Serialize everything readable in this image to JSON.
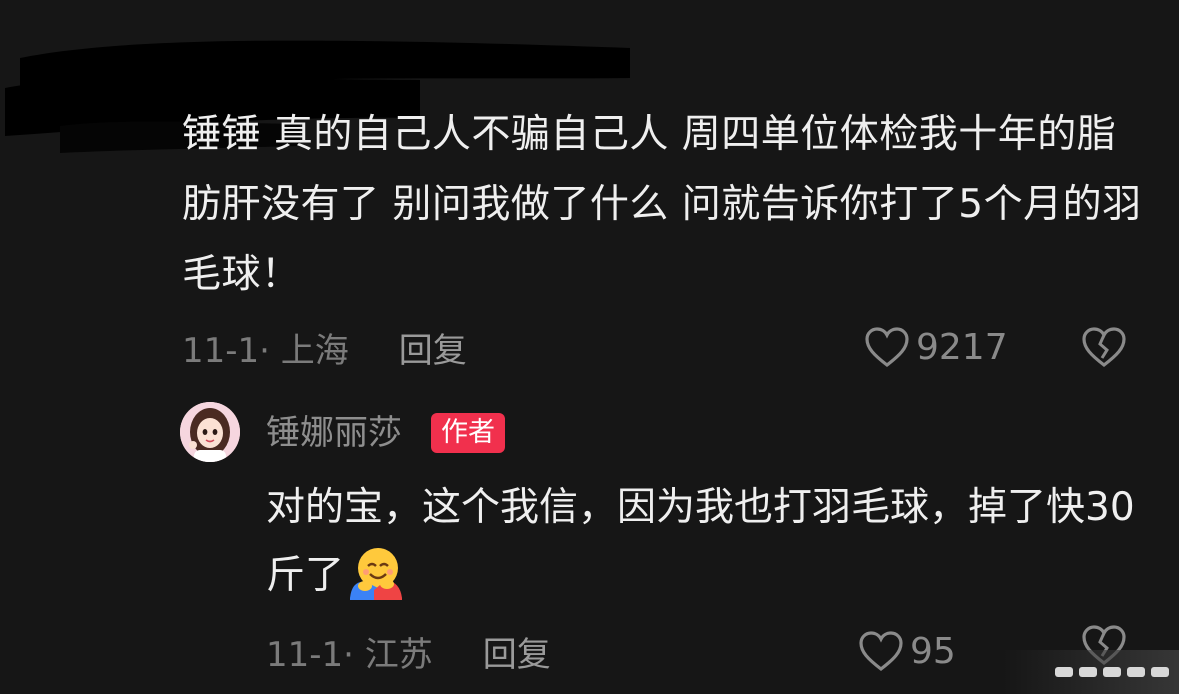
{
  "comment": {
    "text": "锤锤 真的自己人不骗自己人 周四单位体检我十年的脂肪肝没有了 别问我做了什么 问就告诉你打了5个月的羽毛球！",
    "date_location": "11-1· 上海",
    "reply_label": "回复",
    "likes": "9217"
  },
  "reply": {
    "username": "锤娜丽莎",
    "badge": "作者",
    "text": "对的宝，这个我信，因为我也打羽毛球，掉了快30斤了",
    "emoji": "hugging-face-icon",
    "date_location": "11-1· 江苏",
    "reply_label": "回复",
    "likes": "95"
  },
  "colors": {
    "background": "#161616",
    "badge": "#f1304d",
    "text": "#efefef",
    "meta": "#7b7b7b"
  }
}
